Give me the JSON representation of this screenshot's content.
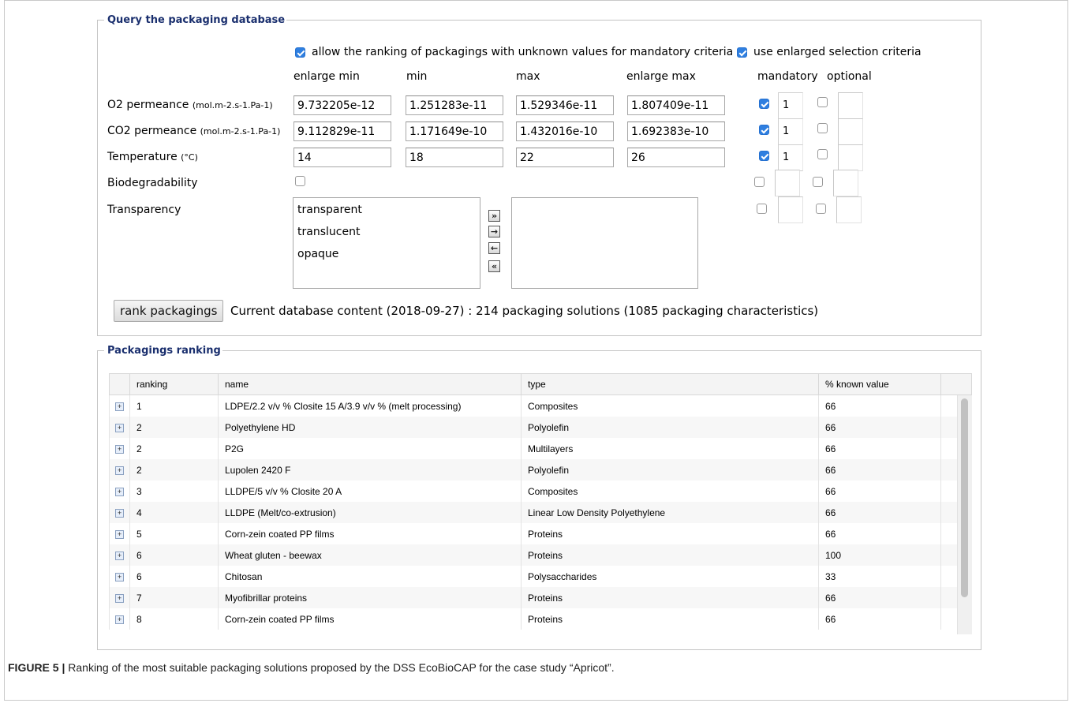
{
  "query": {
    "legend": "Query the packaging database",
    "allow_unknown_label": "allow the ranking of packagings with unknown values for mandatory criteria",
    "enlarged_label": "use enlarged selection criteria",
    "headers": {
      "enlarge_min": "enlarge min",
      "min": "min",
      "max": "max",
      "enlarge_max": "enlarge max",
      "mandatory": "mandatory",
      "optional": "optional"
    },
    "criteria": [
      {
        "name": "O2 permeance",
        "unit": "(mol.m-2.s-1.Pa-1)",
        "enlarge_min": "9.732205e-12",
        "min": "1.251283e-11",
        "max": "1.529346e-11",
        "enlarge_max": "1.807409e-11",
        "mandatory_checked": true,
        "mandatory_value": "1",
        "optional_checked": false,
        "optional_value": ""
      },
      {
        "name": "CO2 permeance",
        "unit": "(mol.m-2.s-1.Pa-1)",
        "enlarge_min": "9.112829e-11",
        "min": "1.171649e-10",
        "max": "1.432016e-10",
        "enlarge_max": "1.692383e-10",
        "mandatory_checked": true,
        "mandatory_value": "1",
        "optional_checked": false,
        "optional_value": ""
      },
      {
        "name": "Temperature",
        "unit": "(°C)",
        "enlarge_min": "14",
        "min": "18",
        "max": "22",
        "enlarge_max": "26",
        "mandatory_checked": true,
        "mandatory_value": "1",
        "optional_checked": false,
        "optional_value": ""
      },
      {
        "name": "Biodegradability",
        "unit": "",
        "checked": false,
        "mandatory_checked": false,
        "mandatory_value": "",
        "optional_checked": false,
        "optional_value": ""
      },
      {
        "name": "Transparency",
        "unit": "",
        "mandatory_checked": false,
        "mandatory_value": "",
        "optional_checked": false,
        "optional_value": ""
      }
    ],
    "transparency_options": [
      "transparent",
      "translucent",
      "opaque"
    ],
    "transfer_buttons": [
      "add-all-icon",
      "add-icon",
      "remove-icon",
      "remove-all-icon"
    ],
    "rank_button": "rank packagings",
    "status": "Current database content (2018-09-27) : 214 packaging solutions (1085 packaging characteristics)"
  },
  "ranking": {
    "legend": "Packagings ranking",
    "columns": [
      "ranking",
      "name",
      "type",
      "% known value"
    ],
    "rows": [
      {
        "ranking": "1",
        "name": "LDPE/2.2 v/v % Closite 15 A/3.9 v/v % (melt processing)",
        "type": "Composites",
        "known": "66"
      },
      {
        "ranking": "2",
        "name": "Polyethylene HD",
        "type": "Polyolefin",
        "known": "66"
      },
      {
        "ranking": "2",
        "name": "P2G",
        "type": "Multilayers",
        "known": "66"
      },
      {
        "ranking": "2",
        "name": "Lupolen 2420 F",
        "type": "Polyolefin",
        "known": "66"
      },
      {
        "ranking": "3",
        "name": "LLDPE/5 v/v % Closite 20 A",
        "type": "Composites",
        "known": "66"
      },
      {
        "ranking": "4",
        "name": "LLDPE (Melt/co-extrusion)",
        "type": "Linear Low Density Polyethylene",
        "known": "66"
      },
      {
        "ranking": "5",
        "name": "Corn-zein coated PP films",
        "type": "Proteins",
        "known": "66"
      },
      {
        "ranking": "6",
        "name": "Wheat gluten - beewax",
        "type": "Proteins",
        "known": "100"
      },
      {
        "ranking": "6",
        "name": "Chitosan",
        "type": "Polysaccharides",
        "known": "33"
      },
      {
        "ranking": "7",
        "name": "Myofibrillar proteins",
        "type": "Proteins",
        "known": "66"
      },
      {
        "ranking": "8",
        "name": "Corn-zein coated PP films",
        "type": "Proteins",
        "known": "66"
      }
    ]
  },
  "caption": {
    "label": "FIGURE 5 |",
    "text": " Ranking of the most suitable packaging solutions proposed by the DSS EcoBioCAP for the case study “Apricot”."
  },
  "colors": {
    "legend": "#1a2f6e",
    "checkbox": "#2f7fe0",
    "border": "#c4c4c4"
  }
}
